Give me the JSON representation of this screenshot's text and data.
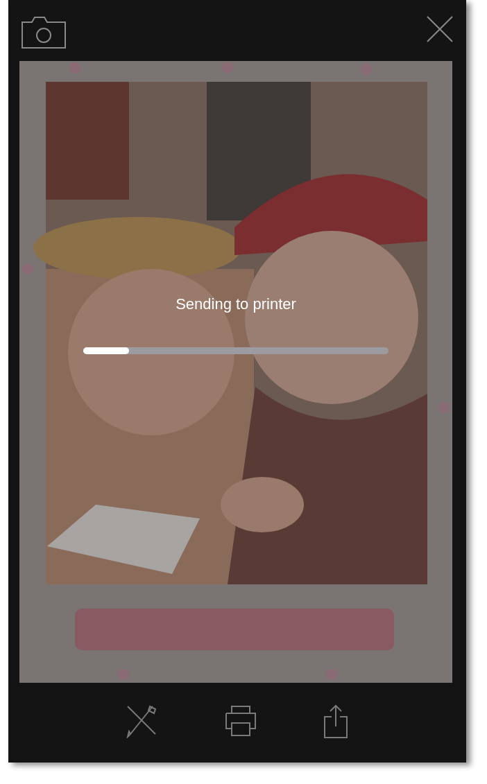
{
  "progress": {
    "message": "Sending to printer",
    "level": 0.15
  }
}
